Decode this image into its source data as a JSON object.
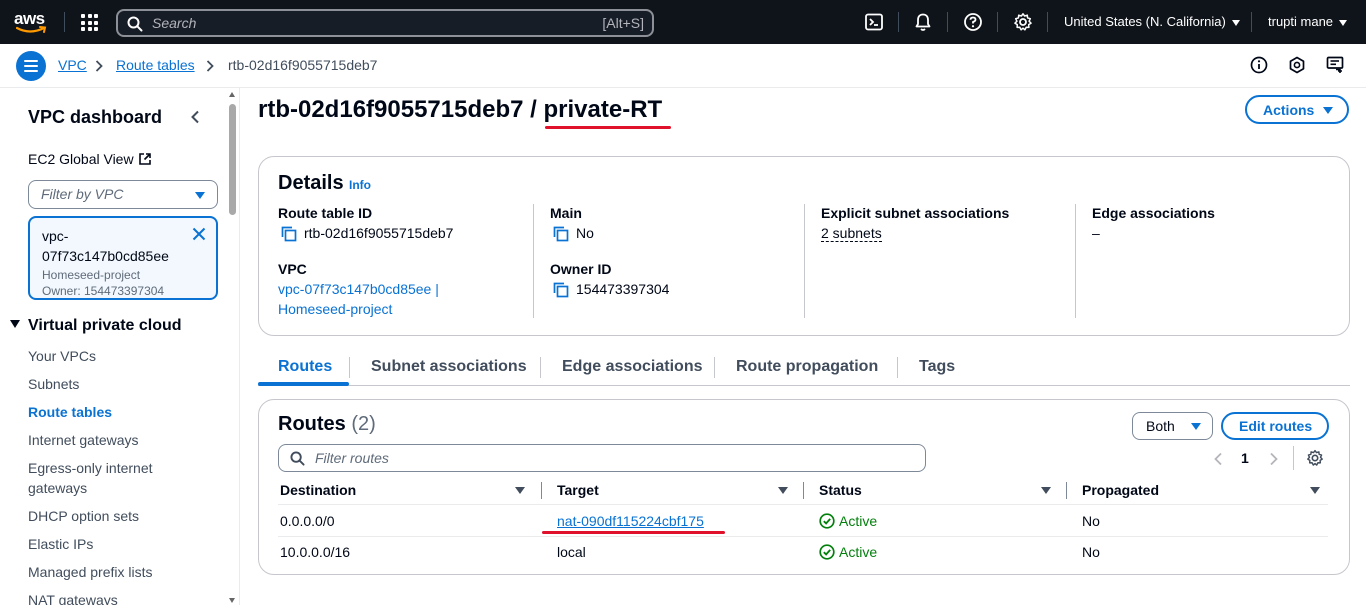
{
  "topnav": {
    "logo_text": "aws",
    "search_placeholder": "Search",
    "search_shortcut": "[Alt+S]",
    "region": "United States (N. California)",
    "user": "trupti mane"
  },
  "breadcrumb": {
    "items": [
      "VPC",
      "Route tables"
    ],
    "current": "rtb-02d16f9055715deb7"
  },
  "sidebar": {
    "title": "VPC dashboard",
    "ec2_global_view": "EC2 Global View",
    "filter_placeholder": "Filter by VPC",
    "selected_vpc": {
      "id": "vpc-07f73c147b0cd85ee",
      "id_line1": "vpc-",
      "id_line2": "07f73c147b0cd85ee",
      "name": "Homeseed-project",
      "owner": "Owner: 154473397304"
    },
    "section": "Virtual private cloud",
    "items": [
      {
        "label": "Your VPCs"
      },
      {
        "label": "Subnets"
      },
      {
        "label": "Route tables",
        "active": true
      },
      {
        "label": "Internet gateways"
      },
      {
        "label": "Egress-only internet gateways"
      },
      {
        "label": "DHCP option sets"
      },
      {
        "label": "Elastic IPs"
      },
      {
        "label": "Managed prefix lists"
      },
      {
        "label": "NAT gateways"
      }
    ]
  },
  "page": {
    "title_id": "rtb-02d16f9055715deb7",
    "title_sep": " / ",
    "title_name": "private-RT",
    "actions": "Actions"
  },
  "details": {
    "heading": "Details",
    "info": "Info",
    "route_table_id_label": "Route table ID",
    "route_table_id": "rtb-02d16f9055715deb7",
    "main_label": "Main",
    "main": "No",
    "explicit_label": "Explicit subnet associations",
    "explicit": "2 subnets",
    "edge_label": "Edge associations",
    "edge": "–",
    "vpc_label": "VPC",
    "vpc_line1": "vpc-07f73c147b0cd85ee |",
    "vpc_line2": "Homeseed-project",
    "owner_label": "Owner ID",
    "owner": "154473397304"
  },
  "tabs": [
    "Routes",
    "Subnet associations",
    "Edge associations",
    "Route propagation",
    "Tags"
  ],
  "routes": {
    "heading": "Routes",
    "count": "(2)",
    "both": "Both",
    "edit": "Edit routes",
    "filter_placeholder": "Filter routes",
    "page": "1",
    "columns": [
      "Destination",
      "Target",
      "Status",
      "Propagated"
    ],
    "rows": [
      {
        "destination": "0.0.0.0/0",
        "target": "nat-090df115224cbf175",
        "status": "Active",
        "propagated": "No"
      },
      {
        "destination": "10.0.0.0/16",
        "target": "local",
        "status": "Active",
        "propagated": "No"
      }
    ]
  },
  "colors": {
    "accent": "#0972d3",
    "success": "#037f0c",
    "annotation": "#e0112b",
    "topnav_bg": "#0f141a"
  }
}
